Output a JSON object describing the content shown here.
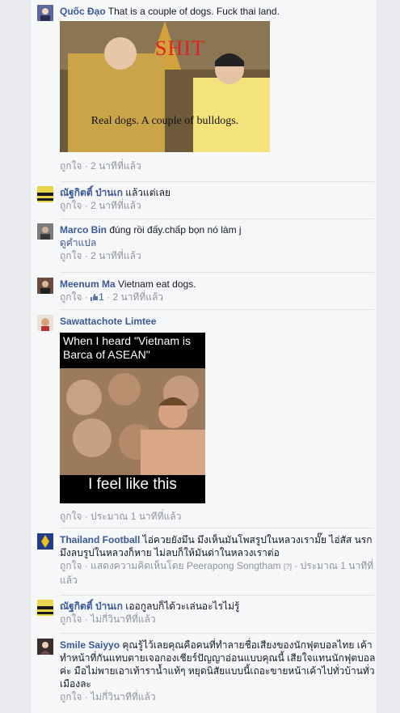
{
  "comments": [
    {
      "author": "Quốc Đạo",
      "text": "That is a couple of dogs. Fuck thai land.",
      "image": {
        "overlay_top": "SHIT",
        "overlay_bottom": "Real dogs. A couple of bulldogs."
      },
      "like": "ถูกใจ",
      "time": "2 นาทีที่แล้ว"
    },
    {
      "author": "ณัฐกิตติ์ ป่านเก",
      "text": "แล้วแต่เลย",
      "like": "ถูกใจ",
      "time": "2 นาทีที่แล้ว"
    },
    {
      "author": "Marco Bin",
      "text": "đúng rồi đấy.chấp bọn nó làm j",
      "translate": "ดูคำแปล",
      "like": "ถูกใจ",
      "time": "2 นาทีที่แล้ว"
    },
    {
      "author": "Meenum Ma",
      "text": "Vietnam eat dogs.",
      "like": "ถูกใจ",
      "like_count": "1",
      "time": "2 นาทีที่แล้ว"
    },
    {
      "author": "Sawattachote Limtee",
      "image": {
        "meme_top": "When I heard  \"Vietnam is Barca of ASEAN\"",
        "meme_bottom": "I feel like this"
      },
      "like": "ถูกใจ",
      "time": "ประมาณ 1 นาทีที่แล้ว"
    },
    {
      "author": "Thailand Football",
      "text": "ไอ่ควยยังมึน มึงเห็นมันโพสรูปในหลวงเรามั๊ย ไอ่สัส นรก มึงลบรูปในหลวงก็หาย ไม่ลบก็ให้มันด่าในหลวงเราต่อ",
      "like": "ถูกใจ",
      "edited": "แสดงความคิดเห็นโดย Peerapong Songtham",
      "qmark": "[?]",
      "time": "ประมาณ 1 นาทีที่แล้ว"
    },
    {
      "author": "ณัฐกิตติ์ ป่านเก",
      "text": "เออกูลบก็ได้วะเล่นอะไรไม่รู้",
      "like": "ถูกใจ",
      "time": "ไม่กี่วินาทีที่แล้ว"
    },
    {
      "author": "Smile Saiyyo",
      "text": "คุณรู้ไว้เลยคุณคือคนที่ทำลายชื่อเสียงของนักฟุตบอลไทย เค้าทำหน้าที่กันแทบตายเจอกองเชียร์ปัญญาอ่อนแบบคุณนี้ เสียใจแทนนักฟุตบอลค่ะ มือไม่พายเอาเท้าราน้ำแท้ๆ หยุดนิสัยแบบนี้เถอะขายหน้าเค้าไปทั่วบ้านทั่วเมืองละ",
      "like": "ถูกใจ",
      "time": "ไม่กี่วินาทีที่แล้ว"
    }
  ],
  "separator": " · ",
  "colors": {
    "link": "#3b5998",
    "meta": "#90949c",
    "background": "#f6f7f9"
  }
}
